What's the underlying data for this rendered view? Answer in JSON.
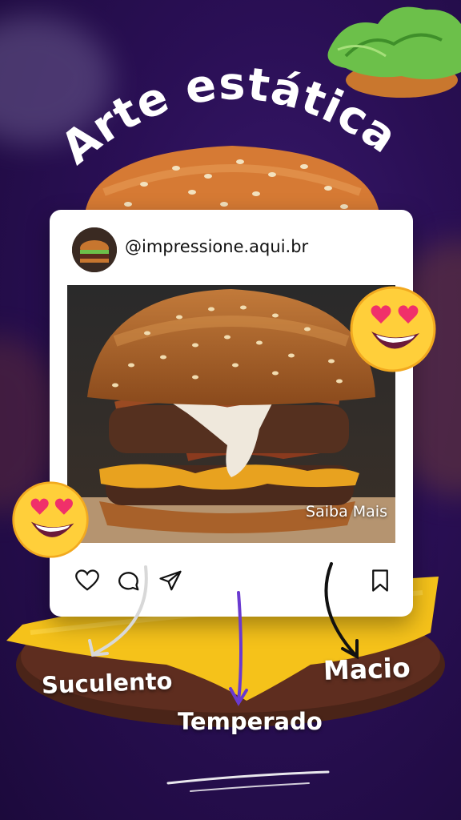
{
  "title": "Arte estática",
  "post": {
    "handle": "@impressione.aqui.br",
    "cta": "Saiba Mais"
  },
  "icons": {
    "like": "heart-icon",
    "comment": "comment-icon",
    "share": "send-icon",
    "save": "bookmark-icon"
  },
  "labels": {
    "suculento": "Suculento",
    "temperado": "Temperado",
    "macio": "Macio"
  },
  "colors": {
    "background": "#2a0f55",
    "cheese": "#f5c21a",
    "card": "#ffffff",
    "arrow_purple": "#6a3ad0"
  }
}
